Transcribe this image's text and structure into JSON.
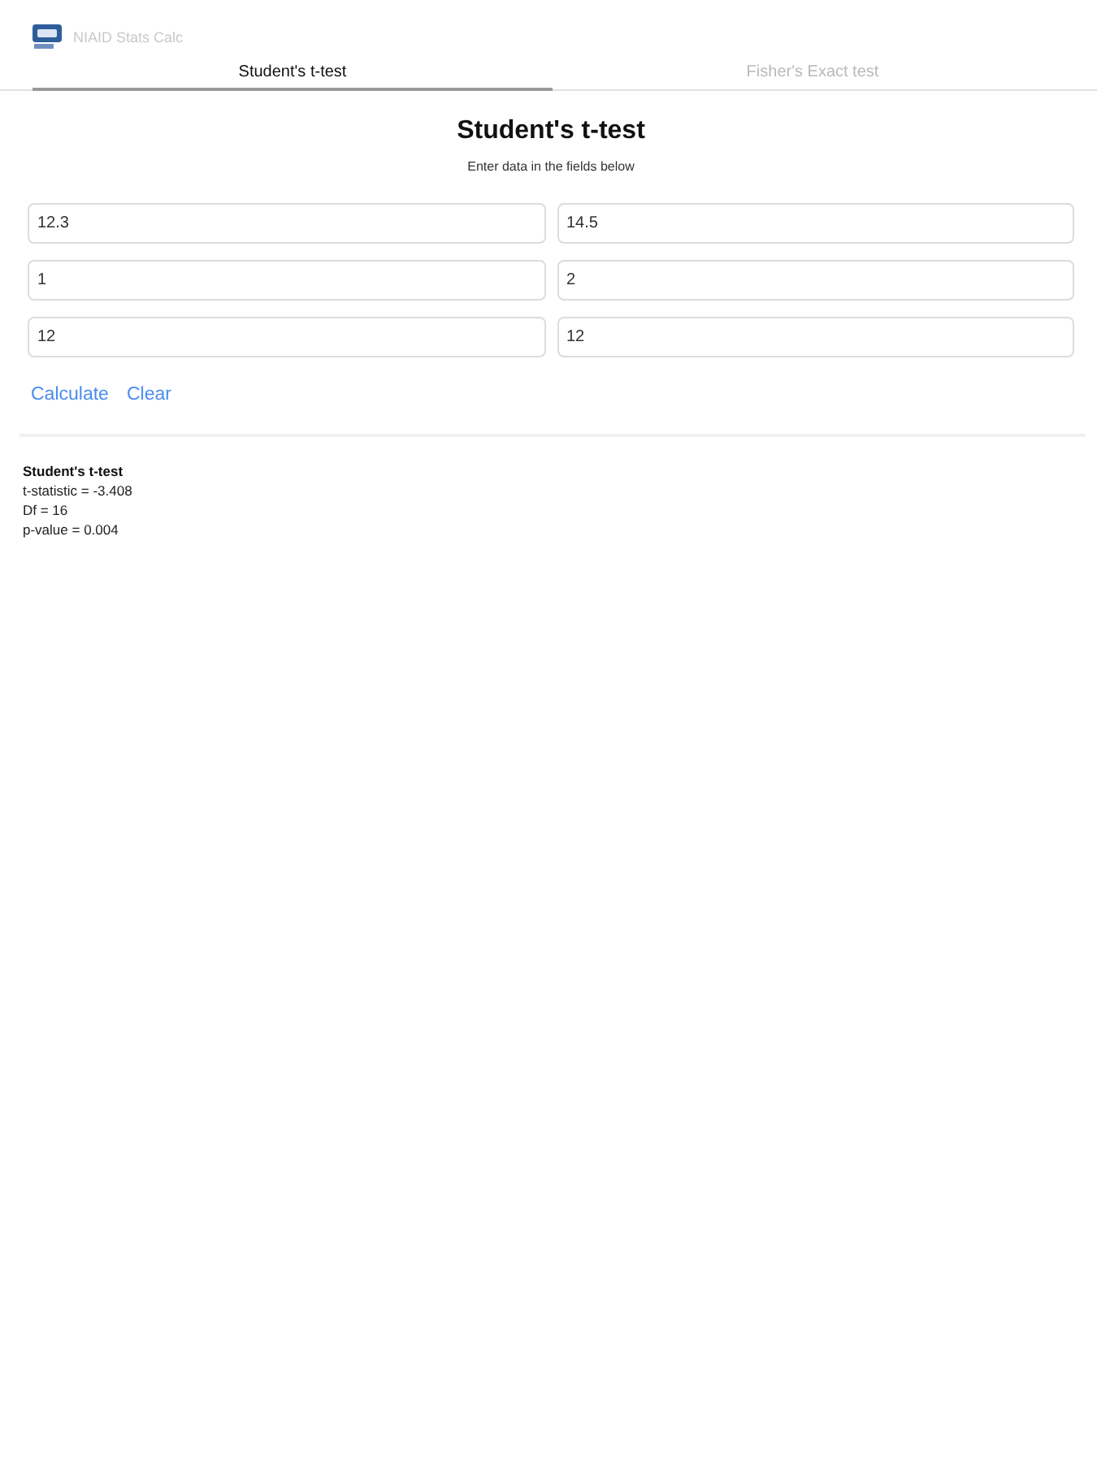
{
  "app": {
    "title": "NIAID Stats Calc"
  },
  "tabs": [
    {
      "label": "Student's t-test",
      "selected": true
    },
    {
      "label": "Fisher's Exact test",
      "selected": false
    }
  ],
  "form": {
    "title": "Student's t-test",
    "subtitle": "Enter data in the fields below",
    "rows": [
      {
        "values": [
          "12.3",
          "14.5"
        ]
      },
      {
        "values": [
          "1",
          "2"
        ]
      },
      {
        "values": [
          "12",
          "12"
        ]
      }
    ],
    "buttons": [
      {
        "label": "Calculate"
      },
      {
        "label": "Clear"
      }
    ]
  },
  "result": {
    "title": "Student's t-test",
    "lines": [
      "t-statistic = -3.408",
      "Df = 16",
      "p-value = 0.004"
    ]
  }
}
